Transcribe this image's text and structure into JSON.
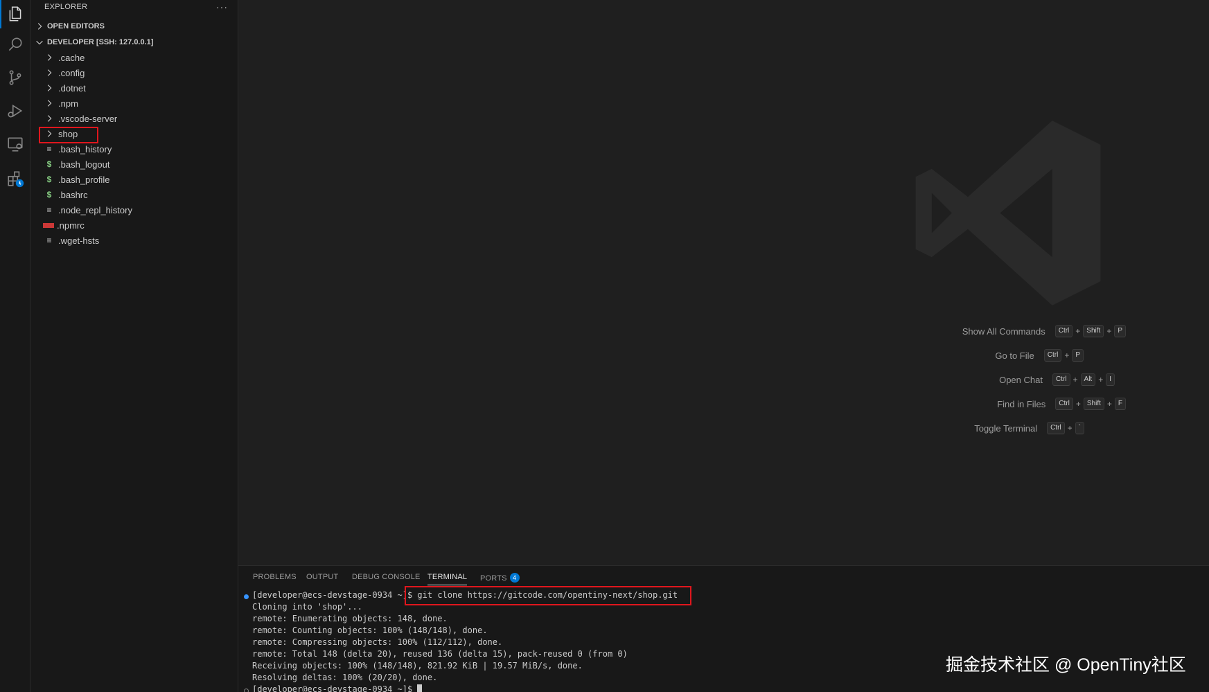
{
  "sidebar": {
    "title": "EXPLORER",
    "more_label": "···",
    "open_editors_label": "OPEN EDITORS",
    "workspace_label": "DEVELOPER [SSH: 127.0.0.1]",
    "folders": [
      ".cache",
      ".config",
      ".dotnet",
      ".npm",
      ".vscode-server",
      "shop"
    ],
    "files": [
      {
        "name": ".bash_history",
        "icon": "lines-icon"
      },
      {
        "name": ".bash_logout",
        "icon": "dollar-icon"
      },
      {
        "name": ".bash_profile",
        "icon": "dollar-icon"
      },
      {
        "name": ".bashrc",
        "icon": "dollar-icon"
      },
      {
        "name": ".node_repl_history",
        "icon": "lines-icon"
      },
      {
        "name": ".npmrc",
        "icon": "npm-icon"
      },
      {
        "name": ".wget-hsts",
        "icon": "lines-icon"
      }
    ]
  },
  "editor": {
    "shortcuts": [
      {
        "label": "Show All Commands",
        "keys": [
          "Ctrl",
          "Shift",
          "P"
        ]
      },
      {
        "label": "Go to File",
        "keys": [
          "Ctrl",
          "P"
        ]
      },
      {
        "label": "Open Chat",
        "keys": [
          "Ctrl",
          "Alt",
          "I"
        ]
      },
      {
        "label": "Find in Files",
        "keys": [
          "Ctrl",
          "Shift",
          "F"
        ]
      },
      {
        "label": "Toggle Terminal",
        "keys": [
          "Ctrl",
          "`"
        ]
      }
    ]
  },
  "panel": {
    "tabs": [
      "PROBLEMS",
      "OUTPUT",
      "DEBUG CONSOLE",
      "TERMINAL",
      "PORTS"
    ],
    "active_tab": "TERMINAL",
    "ports_badge": "4",
    "terminal": {
      "prompt": "[developer@ecs-devstage-0934 ~]$ ",
      "command": "git clone https://gitcode.com/opentiny-next/shop.git",
      "output": [
        "Cloning into 'shop'...",
        "remote: Enumerating objects: 148, done.",
        "remote: Counting objects: 100% (148/148), done.",
        "remote: Compressing objects: 100% (112/112), done.",
        "remote: Total 148 (delta 20), reused 136 (delta 15), pack-reused 0 (from 0)",
        "Receiving objects: 100% (148/148), 821.92 KiB | 19.57 MiB/s, done.",
        "Resolving deltas: 100% (20/20), done."
      ],
      "last_prompt": "[developer@ecs-devstage-0934 ~]$ "
    }
  },
  "watermark": "掘金技术社区 @ OpenTiny社区",
  "colors": {
    "accent": "#0078d4",
    "highlight": "#e0161d",
    "background": "#1f1f1f",
    "sidebar": "#181818"
  }
}
